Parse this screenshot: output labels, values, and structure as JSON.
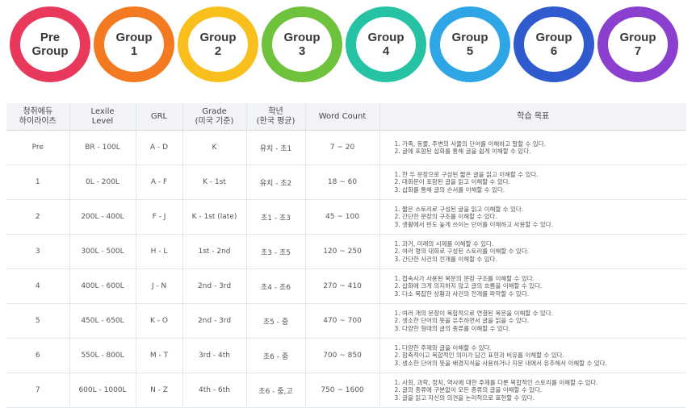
{
  "rings": [
    {
      "label": "Pre\nGroup",
      "color": "#e8395d"
    },
    {
      "label": "Group\n1",
      "color": "#f47a22"
    },
    {
      "label": "Group\n2",
      "color": "#f8bf1d"
    },
    {
      "label": "Group\n3",
      "color": "#6fc23c"
    },
    {
      "label": "Group\n4",
      "color": "#25c3a3"
    },
    {
      "label": "Group\n5",
      "color": "#2ea6e6"
    },
    {
      "label": "Group\n6",
      "color": "#2f5bcf"
    },
    {
      "label": "Group\n7",
      "color": "#8a3fcf"
    }
  ],
  "table": {
    "headers": [
      "청취에듀\n하이라이츠",
      "Lexile\nLevel",
      "GRL",
      "Grade\n(미국 기준)",
      "학년\n(한국 평균)",
      "Word Count",
      "학습 목표"
    ],
    "rows": [
      {
        "group": "Pre",
        "lexile": "BR - 100L",
        "grl": "A - D",
        "grade": "K",
        "korean": "유치 - 초1",
        "words": "7 ~ 20",
        "goals": [
          "1. 가족, 동물, 주변의 사물의 단어를 이해하고 말할 수 있다.",
          "2. 글에 포함된 삽화를 통해 글을 쉽게 이해할 수 있다."
        ]
      },
      {
        "group": "1",
        "lexile": "0L - 200L",
        "grl": "A - F",
        "grade": "K - 1st",
        "korean": "유치 - 초2",
        "words": "18 ~ 60",
        "goals": [
          "1. 한 두 문장으로 구성된 짧은 글을 읽고 이해할 수 있다.",
          "2. 대화문이 포함된 글을 읽고 이해할 수 있다.",
          "3. 삽화를 통해 글의 순서를 이해할 수 있다."
        ]
      },
      {
        "group": "2",
        "lexile": "200L - 400L",
        "grl": "F - J",
        "grade": "K - 1st (late)",
        "korean": "초1 - 초3",
        "words": "45 ~ 100",
        "goals": [
          "1. 짧은 스토리로 구성된 글을 읽고 이해할 수 있다.",
          "2. 간단한 문장의 구조를 이해할 수 있다.",
          "3. 생활에서 빈도 높게 쓰이는 단어를 이해하고 사용할 수 있다."
        ]
      },
      {
        "group": "3",
        "lexile": "300L - 500L",
        "grl": "H - L",
        "grade": "1st - 2nd",
        "korean": "초3 - 초5",
        "words": "120 ~ 250",
        "goals": [
          "1. 과거, 미래의 시제를 이해할 수 있다.",
          "2. 여러 명의 대화로 구성된 스토리를 이해할 수 있다.",
          "3. 간단한 사건의 전개를 이해할 수 있다."
        ]
      },
      {
        "group": "4",
        "lexile": "400L - 600L",
        "grl": "J - N",
        "grade": "2nd - 3rd",
        "korean": "초4 - 초6",
        "words": "270 ~ 410",
        "goals": [
          "1. 접속사가 사용된 복문의 문장 구조를 이해할 수 있다.",
          "2. 삽화에 크게 의지하지 않고 글의 흐름을 이해할 수 있다.",
          "3. 다소 복잡한 상황과 사건의 전개를 파악할 수 있다."
        ]
      },
      {
        "group": "5",
        "lexile": "450L - 650L",
        "grl": "K - O",
        "grade": "2nd - 3rd",
        "korean": "초5 - 중",
        "words": "470 ~ 700",
        "goals": [
          "1. 여러 개의 문장이 복합적으로 연결된 복문을 이해할 수 있다.",
          "2. 생소한 단어의 뜻을 유추하면서 글을 읽을 수 있다.",
          "3. 다양한 형태의 글의 종류를 이해할 수 있다."
        ]
      },
      {
        "group": "6",
        "lexile": "550L - 800L",
        "grl": "M - T",
        "grade": "3rd - 4th",
        "korean": "초6 - 중",
        "words": "700 ~ 850",
        "goals": [
          "1. 다양한 주제와 글을 이해할 수 있다.",
          "2. 함축적이고 복합적인 의미가 담긴 표현과 비유를 이해할 수 있다.",
          "3. 생소한 단어의 뜻을 배경지식을 사용하거나 지문 내에서 유추해서 이해할 수 있다."
        ]
      },
      {
        "group": "7",
        "lexile": "600L - 1000L",
        "grl": "N - Z",
        "grade": "4th - 6th",
        "korean": "초6 - 중,고",
        "words": "750 ~ 1600",
        "goals": [
          "1. 사회, 과학, 정치, 역사에 대한 주제를 다룬 복합적인 스토리를 이해할 수 있다.",
          "2. 글의 종류에 구분없이 모든 종류의 글을 이해할 수 있다.",
          "3. 글을 읽고 자신의 의견을 논리적으로 표현할 수 있다."
        ]
      }
    ]
  }
}
